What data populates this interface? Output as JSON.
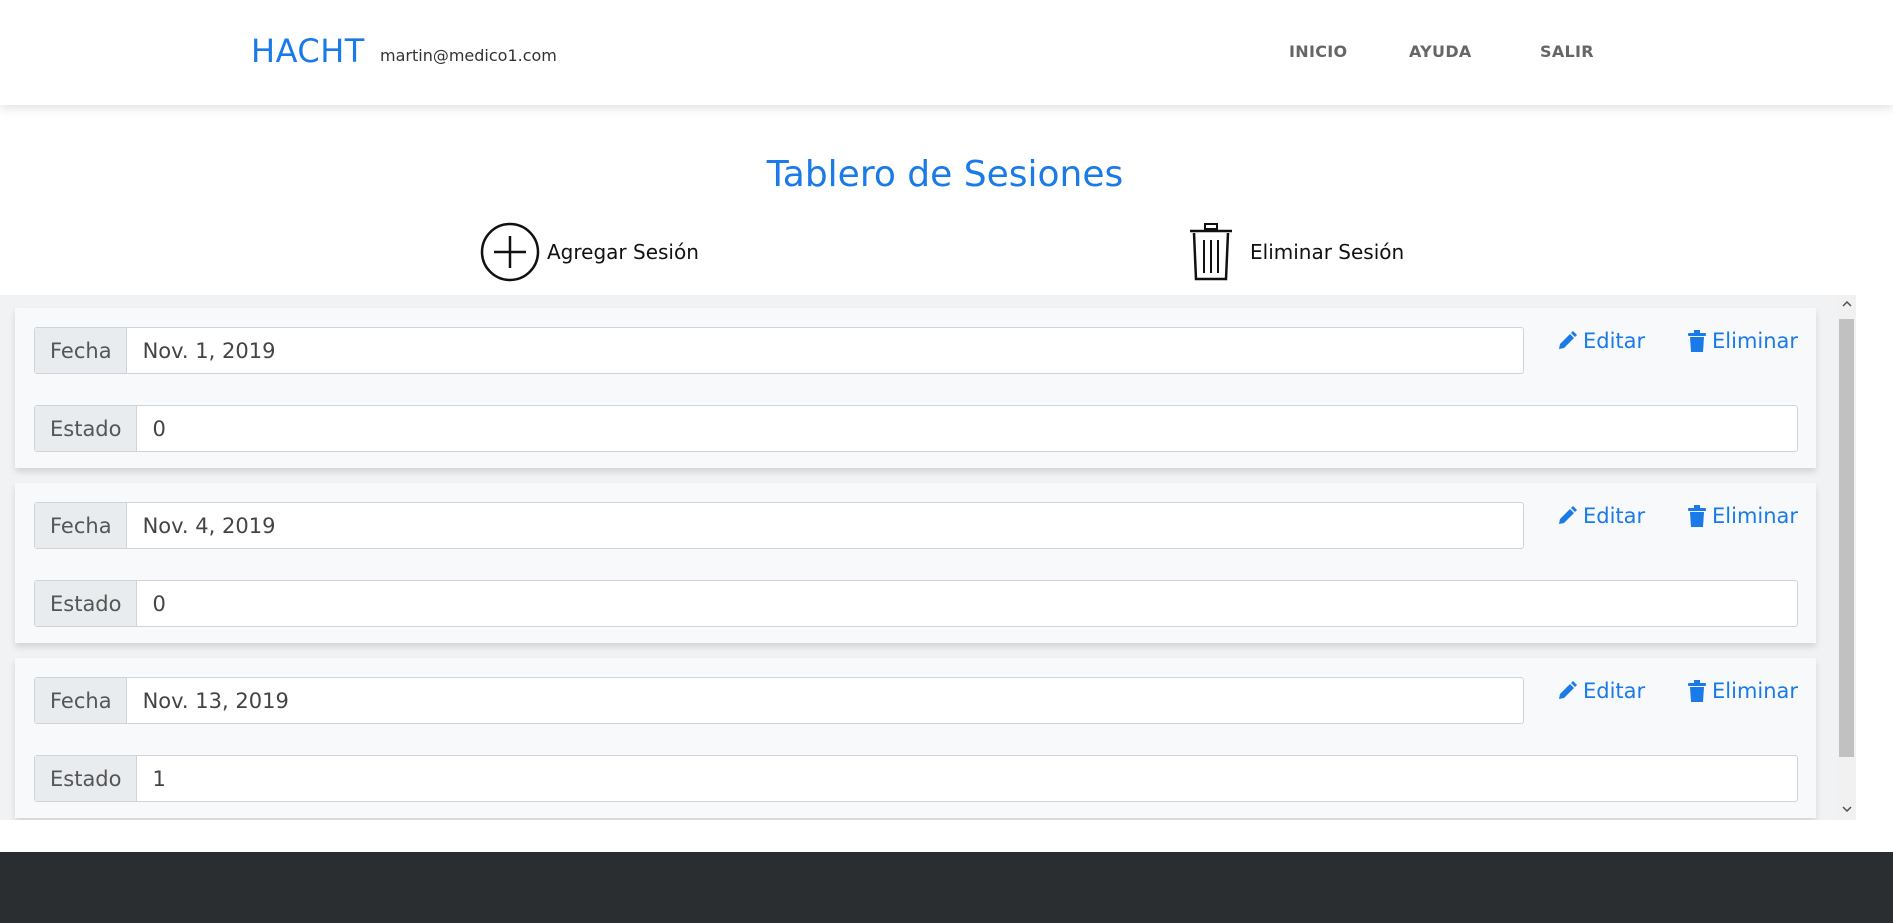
{
  "header": {
    "brand": "HACHT",
    "user_email": "martin@medico1.com",
    "nav": [
      {
        "label": "INICIO"
      },
      {
        "label": "AYUDA"
      },
      {
        "label": "SALIR"
      }
    ]
  },
  "main": {
    "title": "Tablero de Sesiones",
    "add_label": "Agregar Sesión",
    "delete_label": "Eliminar Sesión"
  },
  "sessions": [
    {
      "fecha_label": "Fecha",
      "fecha": "Nov. 1, 2019",
      "estado_label": "Estado",
      "estado": "0",
      "edit_label": "Editar",
      "delete_label": "Eliminar"
    },
    {
      "fecha_label": "Fecha",
      "fecha": "Nov. 4, 2019",
      "estado_label": "Estado",
      "estado": "0",
      "edit_label": "Editar",
      "delete_label": "Eliminar"
    },
    {
      "fecha_label": "Fecha",
      "fecha": "Nov. 13, 2019",
      "estado_label": "Estado",
      "estado": "1",
      "edit_label": "Editar",
      "delete_label": "Eliminar"
    }
  ],
  "icons": {
    "add": "plus-circle-icon",
    "delete": "trash-icon",
    "edit": "pencil-icon",
    "remove": "trash-solid-icon"
  },
  "colors": {
    "accent": "#1a7ae8",
    "footer": "#2b2e30",
    "panel": "#f1f2f3"
  }
}
